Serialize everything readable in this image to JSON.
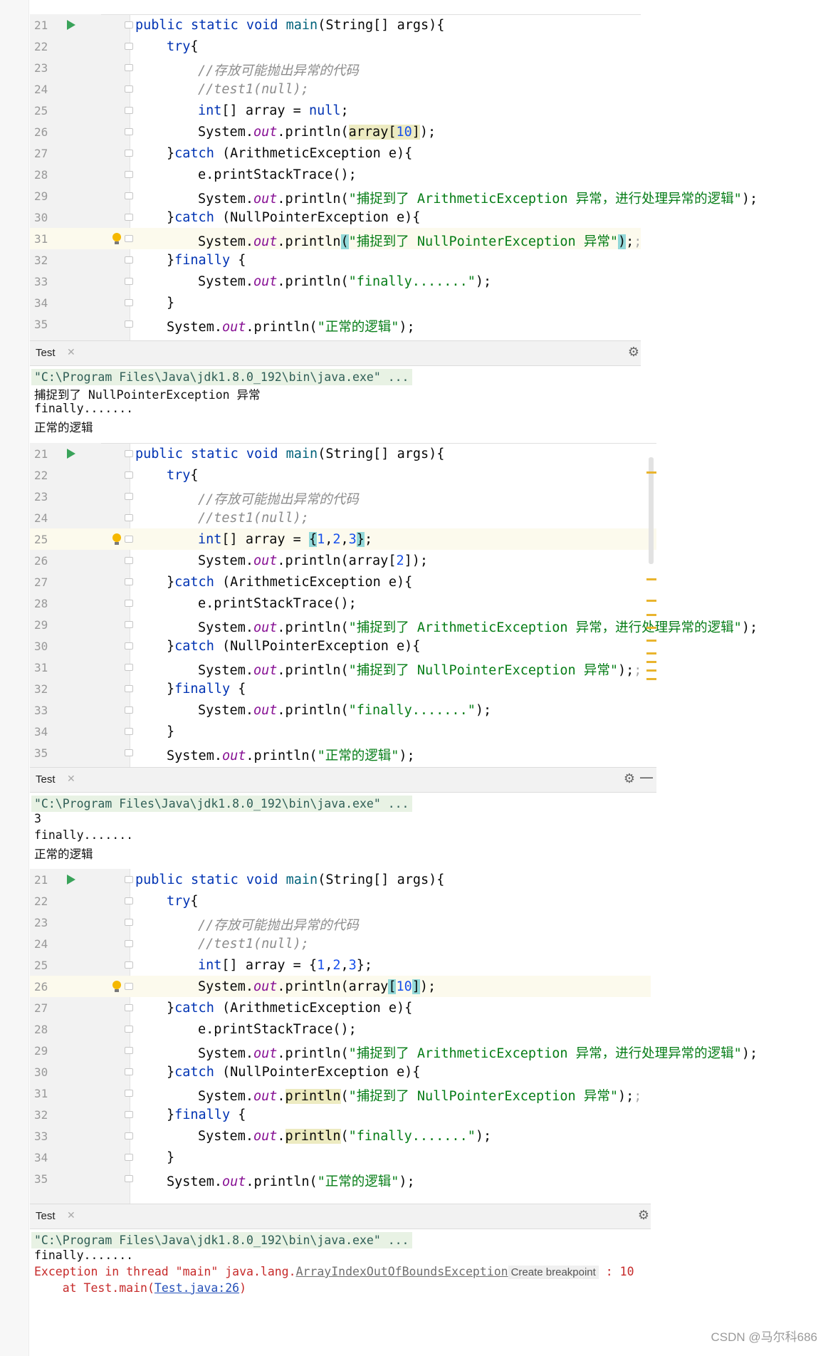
{
  "panels": [
    {
      "lines": [
        {
          "n": "21",
          "html": "<span class='kw'>public static void</span> <span class='fn'>main</span>(String[] args){",
          "indent": 0,
          "run": true
        },
        {
          "n": "22",
          "html": "<span class='kw'>try</span>{",
          "indent": 1
        },
        {
          "n": "23",
          "html": "<span class='cm'>//存放可能抛出异常的代码</span>",
          "indent": 2
        },
        {
          "n": "24",
          "html": "<span class='cm'>//test1(null);</span>",
          "indent": 2
        },
        {
          "n": "25",
          "html": "<span class='kw'>int</span>[] array = <span class='kw'>null</span>;",
          "indent": 2
        },
        {
          "n": "26",
          "html": "System.<span class='fld'>out</span>.println(<span class='mk'>array[<span class='num'>10</span>]</span>);",
          "indent": 2
        },
        {
          "n": "27",
          "html": "}<span class='kw'>catch</span> (ArithmeticException e){",
          "indent": 1
        },
        {
          "n": "28",
          "html": "e.printStackTrace();",
          "indent": 2
        },
        {
          "n": "29",
          "html": "System.<span class='fld'>out</span>.println(<span class='st'>\"捕捉到了 ArithmeticException 异常，进行处理异常的逻辑\"</span>);",
          "indent": 2
        },
        {
          "n": "30",
          "html": "}<span class='kw'>catch</span> (NullPointerException e){",
          "indent": 1
        },
        {
          "n": "31",
          "html": "System.<span class='fld'>out</span>.println<span class='bm'>(</span><span class='st'>\"捕捉到了 NullPointerException 异常\"</span><span class='bm'>)</span>;<span class='sc'>;</span>",
          "indent": 2,
          "hl": true,
          "bulb": true
        },
        {
          "n": "32",
          "html": "}<span class='kw'>finally</span> {",
          "indent": 1
        },
        {
          "n": "33",
          "html": "System.<span class='fld'>out</span>.println(<span class='st'>\"finally.......\"</span>);",
          "indent": 2
        },
        {
          "n": "34",
          "html": "}",
          "indent": 1
        },
        {
          "n": "35",
          "html": "System.<span class='fld'>out</span>.println(<span class='st'>\"正常的逻辑\"</span>);",
          "indent": 1
        }
      ],
      "tab": "Test",
      "console": [
        {
          "text": "\"C:\\Program Files\\Java\\jdk1.8.0_192\\bin\\java.exe\" ...",
          "cls": "cmdline"
        },
        {
          "text": "捕捉到了 NullPointerException 异常"
        },
        {
          "text": "finally......."
        },
        {
          "text": "正常的逻辑"
        }
      ]
    },
    {
      "lines": [
        {
          "n": "21",
          "html": "<span class='kw'>public static void</span> <span class='fn'>main</span>(String[] args){",
          "indent": 0,
          "run": true
        },
        {
          "n": "22",
          "html": "<span class='kw'>try</span>{",
          "indent": 1
        },
        {
          "n": "23",
          "html": "<span class='cm'>//存放可能抛出异常的代码</span>",
          "indent": 2
        },
        {
          "n": "24",
          "html": "<span class='cm'>//test1(null);</span>",
          "indent": 2
        },
        {
          "n": "25",
          "html": "<span class='kw'>int</span>[] array = <span class='bm'>{</span><span class='num'>1</span>,<span class='num'>2</span>,<span class='num'>3</span><span class='bm'>}</span>;",
          "indent": 2,
          "hl": true,
          "bulb": true
        },
        {
          "n": "26",
          "html": "System.<span class='fld'>out</span>.println(array[<span class='num'>2</span>]);",
          "indent": 2
        },
        {
          "n": "27",
          "html": "}<span class='kw'>catch</span> (ArithmeticException e){",
          "indent": 1
        },
        {
          "n": "28",
          "html": "e.printStackTrace();",
          "indent": 2
        },
        {
          "n": "29",
          "html": "System.<span class='fld'>out</span>.println(<span class='st'>\"捕捉到了 ArithmeticException 异常，进行处理异常的逻辑\"</span>);",
          "indent": 2
        },
        {
          "n": "30",
          "html": "}<span class='kw'>catch</span> (NullPointerException e){",
          "indent": 1
        },
        {
          "n": "31",
          "html": "System.<span class='fld'>out</span>.println(<span class='st'>\"捕捉到了 NullPointerException 异常\"</span>);<span class='sc'>;</span>",
          "indent": 2
        },
        {
          "n": "32",
          "html": "}<span class='kw'>finally</span> {",
          "indent": 1
        },
        {
          "n": "33",
          "html": "System.<span class='fld'>out</span>.println(<span class='st'>\"finally.......\"</span>);",
          "indent": 2
        },
        {
          "n": "34",
          "html": "}",
          "indent": 1
        },
        {
          "n": "35",
          "html": "System.<span class='fld'>out</span>.println(<span class='st'>\"正常的逻辑\"</span>);",
          "indent": 1
        }
      ],
      "tab": "Test",
      "console": [
        {
          "text": "\"C:\\Program Files\\Java\\jdk1.8.0_192\\bin\\java.exe\" ...",
          "cls": "cmdline"
        },
        {
          "text": "3"
        },
        {
          "text": "finally......."
        },
        {
          "text": "正常的逻辑"
        }
      ]
    },
    {
      "lines": [
        {
          "n": "21",
          "html": "<span class='kw'>public static void</span> <span class='fn'>main</span>(String[] args){",
          "indent": 0,
          "run": true
        },
        {
          "n": "22",
          "html": "<span class='kw'>try</span>{",
          "indent": 1
        },
        {
          "n": "23",
          "html": "<span class='cm'>//存放可能抛出异常的代码</span>",
          "indent": 2
        },
        {
          "n": "24",
          "html": "<span class='cm'>//test1(null);</span>",
          "indent": 2
        },
        {
          "n": "25",
          "html": "<span class='kw'>int</span>[] array = {<span class='num'>1</span>,<span class='num'>2</span>,<span class='num'>3</span>};",
          "indent": 2
        },
        {
          "n": "26",
          "html": "System.<span class='fld'>out</span>.println(array<span class='bm'>[</span><span class='num'>10</span><span class='bm'>]</span>);",
          "indent": 2,
          "hl": true,
          "bulb": true
        },
        {
          "n": "27",
          "html": "}<span class='kw'>catch</span> (ArithmeticException e){",
          "indent": 1
        },
        {
          "n": "28",
          "html": "e.printStackTrace();",
          "indent": 2
        },
        {
          "n": "29",
          "html": "System.<span class='fld'>out</span>.println(<span class='st'>\"捕捉到了 ArithmeticException 异常，进行处理异常的逻辑\"</span>);",
          "indent": 2
        },
        {
          "n": "30",
          "html": "}<span class='kw'>catch</span> (NullPointerException e){",
          "indent": 1
        },
        {
          "n": "31",
          "html": "System.<span class='fld'>out</span>.<span class='mk'>println</span>(<span class='st'>\"捕捉到了 NullPointerException 异常\"</span>);<span class='sc'>;</span>",
          "indent": 2
        },
        {
          "n": "32",
          "html": "}<span class='kw'>finally</span> {",
          "indent": 1
        },
        {
          "n": "33",
          "html": "System.<span class='fld'>out</span>.<span class='mk'>println</span>(<span class='st'>\"finally.......\"</span>);",
          "indent": 2
        },
        {
          "n": "34",
          "html": "}",
          "indent": 1
        },
        {
          "n": "35",
          "html": "System.<span class='fld'>out</span>.println(<span class='st'>\"正常的逻辑\"</span>);",
          "indent": 1
        }
      ],
      "tab": "Test",
      "console": [
        {
          "text": "\"C:\\Program Files\\Java\\jdk1.8.0_192\\bin\\java.exe\" ...",
          "cls": "cmdline"
        },
        {
          "text": "finally......."
        },
        {
          "err": true,
          "prefix": "Exception in thread \"main\" java.lang.",
          "exc": "ArrayIndexOutOfBoundsException",
          "hint": "Create breakpoint",
          "suffix": " : 10"
        },
        {
          "at": true,
          "prefix": "    at Test.main(",
          "link": "Test.java:26",
          "suffix": ")"
        }
      ]
    }
  ],
  "watermark": "CSDN @马尔科686"
}
